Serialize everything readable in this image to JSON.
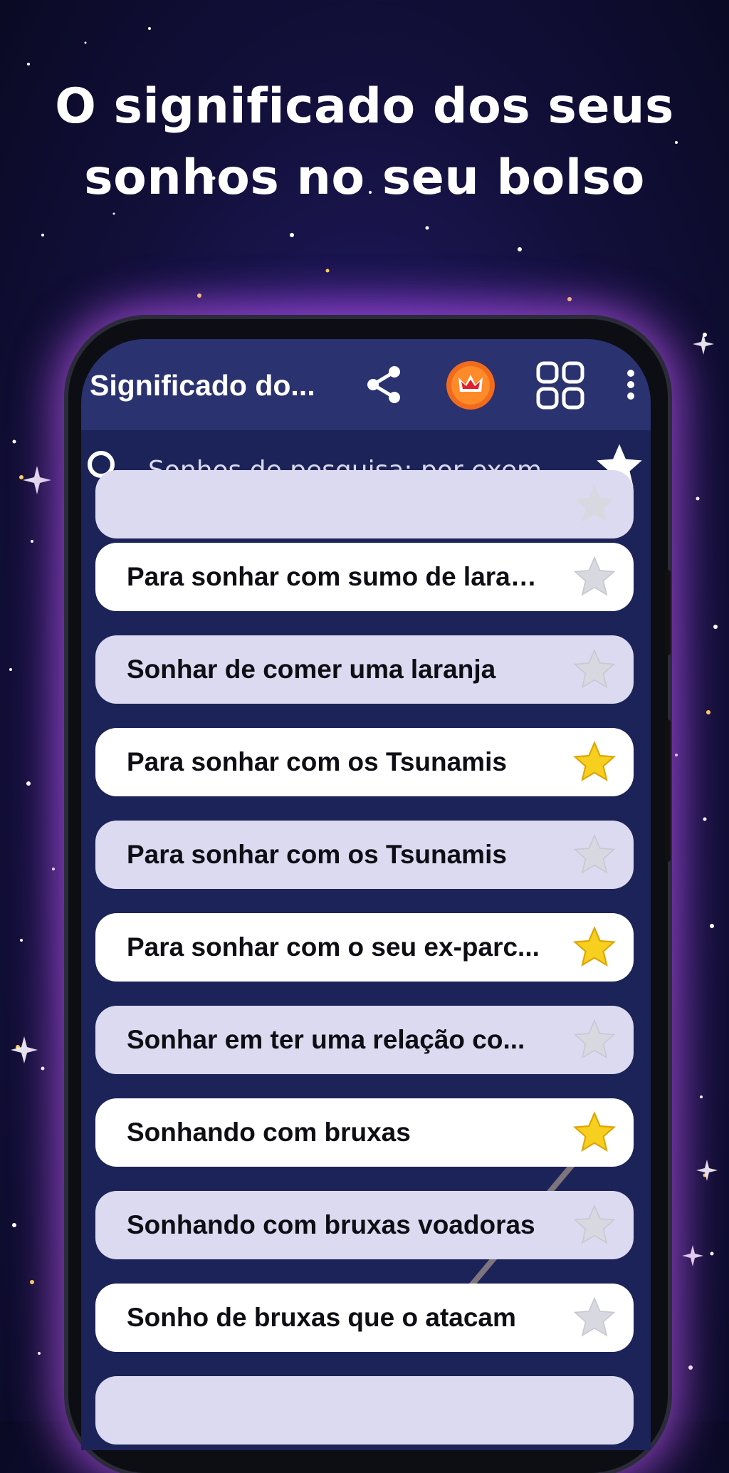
{
  "headline": {
    "line1": "O significado dos seus",
    "line2": "sonhos no seu bolso"
  },
  "appbar": {
    "title": "Significado do...",
    "icons": [
      "share-icon",
      "crown-premium-icon",
      "grid-apps-icon",
      "more-vert-icon"
    ]
  },
  "search": {
    "placeholder": "Sonhos de pesquisa: por exem...",
    "value": "",
    "favorites_icon": "star-icon"
  },
  "dreams": [
    {
      "label": "",
      "favorite": false,
      "partial": true
    },
    {
      "label": "Para sonhar com sumo de laranja",
      "favorite": false
    },
    {
      "label": "Sonhar de comer uma laranja",
      "favorite": false
    },
    {
      "label": "Para sonhar com os Tsunamis",
      "favorite": true
    },
    {
      "label": "Para sonhar com os Tsunamis",
      "favorite": false
    },
    {
      "label": "Para sonhar com o seu ex-parc...",
      "favorite": true
    },
    {
      "label": "Sonhar em ter uma relação co...",
      "favorite": false
    },
    {
      "label": "Sonhando com bruxas",
      "favorite": true
    },
    {
      "label": "Sonhando com bruxas voadoras",
      "favorite": false
    },
    {
      "label": "Sonho de bruxas que o atacam",
      "favorite": false
    }
  ],
  "colors": {
    "star_active": "#f6cf1f",
    "star_inactive": "#d8d8e0",
    "appbar": "#2a3270",
    "list_bg": "#1c2358",
    "premium": "#f26a1b"
  }
}
